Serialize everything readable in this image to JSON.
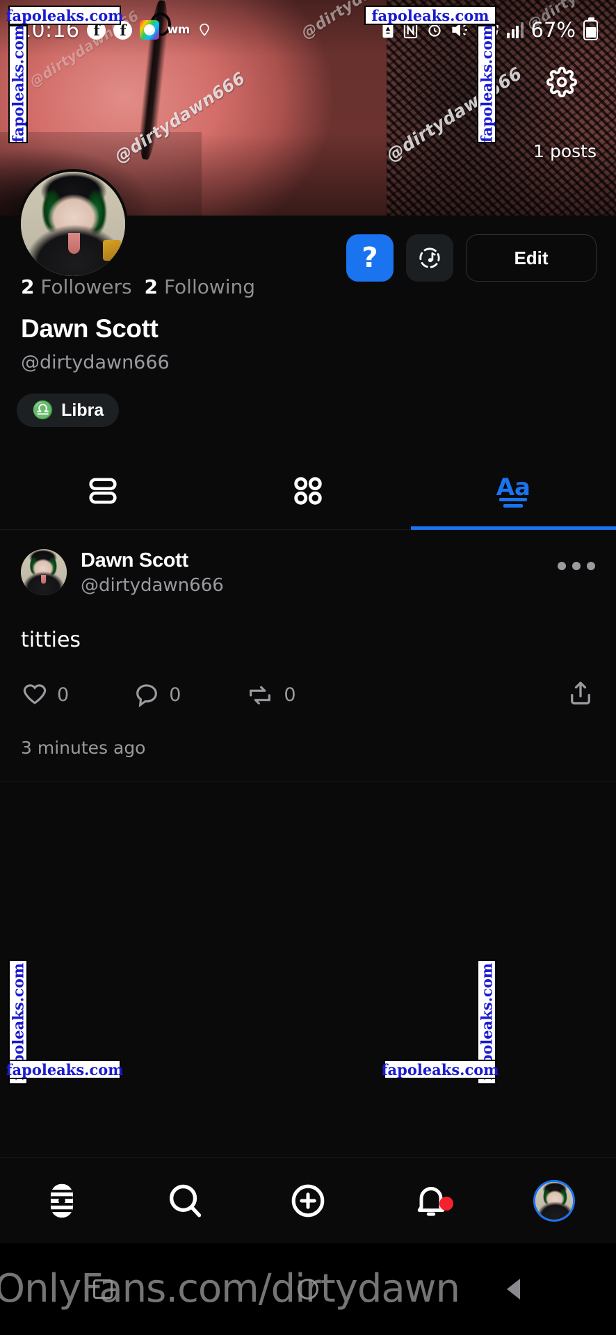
{
  "status_bar": {
    "clock": "10:16",
    "battery_percent": "67%",
    "network": "5G",
    "icons": [
      "facebook-icon",
      "facebook-icon",
      "rainbow-app-icon",
      "wm-icon",
      "location-icon",
      "eco-battery-icon",
      "nfc-icon",
      "alarm-icon",
      "mute-icon",
      "5g-icon",
      "signal-bars-icon",
      "battery-icon"
    ]
  },
  "cover": {
    "posts_count": "1 posts",
    "username_watermark": "@dirtydawn666",
    "settings_icon": "gear-icon"
  },
  "profile": {
    "display_name": "Dawn Scott",
    "handle": "@dirtydawn666",
    "followers_count": "2",
    "followers_label": "Followers",
    "following_count": "2",
    "following_label": "Following",
    "zodiac": "Libra",
    "zodiac_symbol": "♎",
    "actions": {
      "help_label": "?",
      "music_label": "music-icon",
      "edit_label": "Edit"
    }
  },
  "tabs": [
    {
      "id": "list",
      "icon": "list-view-icon",
      "active": false
    },
    {
      "id": "grid",
      "icon": "grid-view-icon",
      "active": false
    },
    {
      "id": "text",
      "icon": "text-posts-icon",
      "label": "Aa",
      "active": true
    }
  ],
  "post": {
    "author_name": "Dawn Scott",
    "author_handle": "@dirtydawn666",
    "body": "titties",
    "timestamp": "3 minutes ago",
    "likes": "0",
    "comments": "0",
    "reposts": "0",
    "more_icon": "more-options-icon",
    "share_icon": "share-icon"
  },
  "bottom_nav": [
    {
      "id": "home",
      "icon": "home-icon",
      "badge": false
    },
    {
      "id": "search",
      "icon": "search-icon",
      "badge": false
    },
    {
      "id": "create",
      "icon": "plus-circle-icon",
      "badge": false
    },
    {
      "id": "notifications",
      "icon": "bell-icon",
      "badge": true
    },
    {
      "id": "profile",
      "icon": "profile-avatar-icon",
      "badge": false
    }
  ],
  "android_nav": [
    {
      "id": "back",
      "icon": "back-triangle-icon"
    },
    {
      "id": "home",
      "icon": "home-circle-icon"
    },
    {
      "id": "recents",
      "icon": "recents-square-icon"
    }
  ],
  "watermarks": {
    "site": "fapoleaks.com",
    "overlay_url": "OnlyFans.com/dirtydawn"
  },
  "colors": {
    "accent": "#1a74f0",
    "background": "#0a0a0a",
    "muted_text": "#9a9aa0",
    "badge": "#f5222d",
    "watermark_text": "#1a1ad0"
  }
}
